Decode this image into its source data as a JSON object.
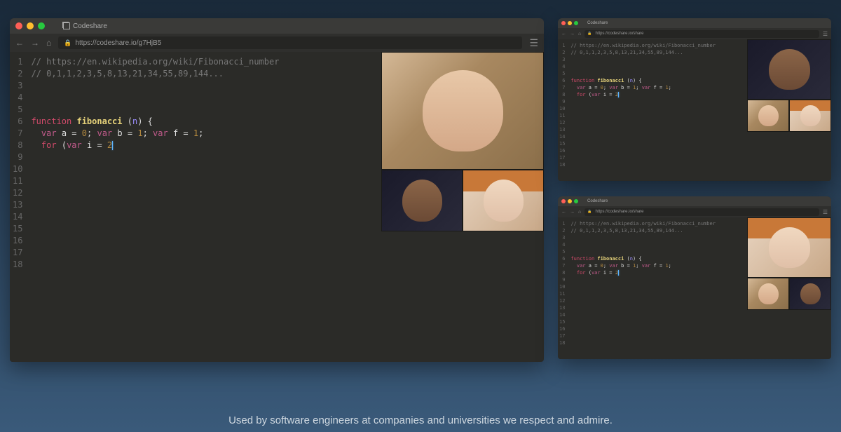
{
  "app": {
    "tab_title": "Codeshare",
    "url": "https://codeshare.io/g7HjB5",
    "url_small": "https://codeshare.io/share"
  },
  "code": {
    "line1": "// https://en.wikipedia.org/wiki/Fibonacci_number",
    "line2": "// 0,1,1,2,3,5,8,13,21,34,55,89,144...",
    "fn_keyword": "function",
    "fn_name": "fibonacci",
    "fn_param": "n",
    "brace_open": "{",
    "var_kw": "var",
    "var_a": "a",
    "eq": "=",
    "zero": "0",
    "one": "1",
    "var_b": "b",
    "var_f": "f",
    "semi": ";",
    "for_kw": "for",
    "paren_open": "(",
    "var_i": "i",
    "two": "2"
  },
  "line_numbers": [
    "1",
    "2",
    "3",
    "4",
    "5",
    "6",
    "7",
    "8",
    "9",
    "10",
    "11",
    "12",
    "13",
    "14",
    "15",
    "16",
    "17",
    "18"
  ],
  "videos": {
    "person1": "participant-1",
    "person2": "participant-2",
    "person3": "participant-3"
  },
  "tagline": "Used by software engineers at companies and universities we respect and admire."
}
